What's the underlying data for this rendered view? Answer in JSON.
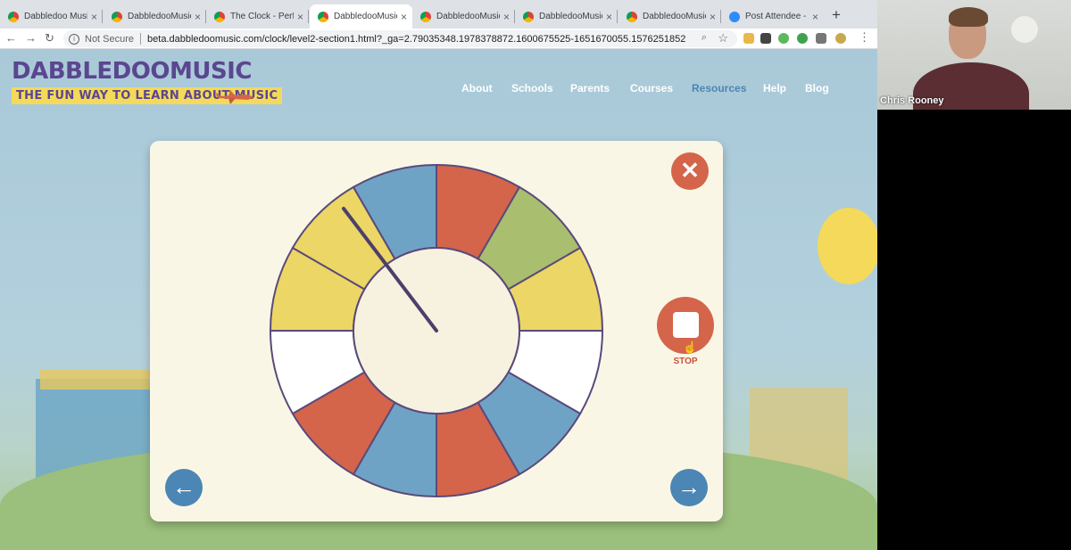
{
  "browser": {
    "tabs": [
      {
        "title": "Dabbledoo Music",
        "favicon": "chrome-favicon",
        "active": false
      },
      {
        "title": "DabbledooMusic |",
        "favicon": "chrome-favicon",
        "active": false
      },
      {
        "title": "The Clock - Perfo",
        "favicon": "chrome-favicon",
        "active": false
      },
      {
        "title": "DabbledooMusic",
        "favicon": "chrome-favicon",
        "active": true
      },
      {
        "title": "DabbledooMusic",
        "favicon": "chrome-favicon",
        "active": false
      },
      {
        "title": "DabbledooMusic",
        "favicon": "chrome-favicon",
        "active": false
      },
      {
        "title": "DabbledooMusic",
        "favicon": "chrome-favicon",
        "active": false
      },
      {
        "title": "Post Attendee - Z",
        "favicon": "zoom-favicon",
        "active": false
      }
    ],
    "security_label": "Not Secure",
    "url": "beta.dabbledoomusic.com/clock/level2-section1.html?_ga=2.79035348.1978378872.1600675525-1651670055.1576251852"
  },
  "site": {
    "logo": "DABBLEDOOMUSIC",
    "tagline": "THE FUN WAY TO LEARN ABOUT MUSIC",
    "nav": [
      {
        "label": "About",
        "active": false
      },
      {
        "label": "Schools",
        "active": false
      },
      {
        "label": "Parents",
        "active": false
      },
      {
        "label": "Courses",
        "active": false
      },
      {
        "label": "Resources",
        "active": true
      },
      {
        "label": "Help",
        "active": false
      },
      {
        "label": "Blog",
        "active": false
      }
    ]
  },
  "activity": {
    "stop_label": "STOP",
    "close_icon": "close-icon",
    "prev_icon": "arrow-left-icon",
    "next_icon": "arrow-right-icon",
    "clock_segments": [
      "red",
      "green",
      "yellow",
      "white",
      "blue",
      "red",
      "blue",
      "red",
      "white",
      "yellow",
      "yellow",
      "blue"
    ],
    "segment_colors": {
      "red": "#d4654a",
      "green": "#a9be6e",
      "yellow": "#ecd665",
      "white": "#ffffff",
      "blue": "#6fa3c6"
    },
    "hand_color": "#4d3f6b"
  },
  "meeting": {
    "participant_name": "Chris Rooney"
  }
}
